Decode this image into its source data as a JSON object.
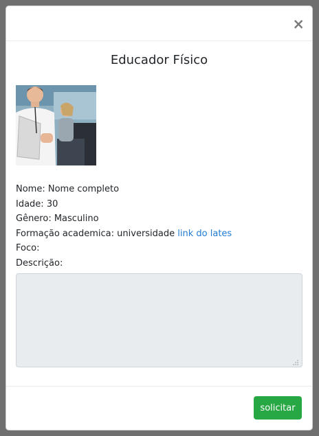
{
  "modal": {
    "close_symbol": "×",
    "title": "Educador Físico",
    "photo_alt": "trainer-photo",
    "fields": {
      "nome_label": "Nome:",
      "nome_value": "Nome completo",
      "idade_label": "Idade:",
      "idade_value": "30",
      "genero_label": "Gênero:",
      "genero_value": "Masculino",
      "formacao_label": "Formação academica:",
      "formacao_value": "universidade",
      "formacao_link": "link do lates",
      "foco_label": "Foco:",
      "descricao_label": "Descrição:"
    },
    "textarea_value": "",
    "submit_label": "solicitar"
  },
  "colors": {
    "backdrop": "#6f6f6f",
    "link": "#1f7bd6",
    "button": "#28a745",
    "textarea_bg": "#e9ecef"
  }
}
